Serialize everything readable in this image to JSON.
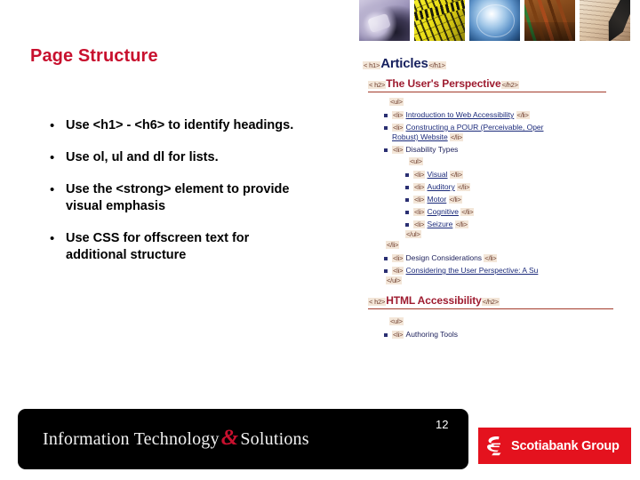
{
  "slide": {
    "title": "Page Structure",
    "page_number": "12"
  },
  "bullets": [
    {
      "marker": "•",
      "text": "Use <h1> - <h6> to identify headings."
    },
    {
      "marker": "•",
      "text": "Use ol, ul and dl for lists."
    },
    {
      "marker": "•",
      "text": "Use the <strong> element to provide visual emphasis"
    },
    {
      "marker": "•",
      "text": "Use CSS for offscreen text for additional structure"
    }
  ],
  "code_screenshot": {
    "h1": {
      "open_tag": "< h1>",
      "title": "Articles",
      "close_tag": "</h1>"
    },
    "h2_user_perspective": {
      "open_tag": "< h2>",
      "title": "The User's Perspective",
      "close_tag": "</h2>"
    },
    "ul_open": "<ul>",
    "ul_open_nested": "<ul>",
    "ul_close_nested": "</ul>",
    "li_close_outer": "</li>",
    "ul_close": "</ul>",
    "li_open": "<li>",
    "li_close": "</li>",
    "items": [
      {
        "label": "Introduction to Web Accessibility",
        "link": true
      },
      {
        "label": "Constructing a POUR (Perceivable, Oper",
        "label2": "Robust) Website",
        "link": true
      },
      {
        "label": "Disability Types",
        "link": false
      }
    ],
    "disability_types": [
      "Visual",
      "Auditory",
      "Motor",
      "Cognitive",
      "Seizure"
    ],
    "items_after": [
      {
        "label": "Design Considerations",
        "link": false
      },
      {
        "label": "Considering the User Perspective: A Su",
        "link": true
      }
    ],
    "h2_html_accessibility": {
      "open_tag": "< h2>",
      "title": "HTML Accessibility",
      "close_tag": "</h2>"
    },
    "ul_open_2": "<ul>",
    "items_html": [
      {
        "label": "Authoring Tools",
        "link": false
      }
    ]
  },
  "footer": {
    "org_part1": "Information Technology",
    "org_amp": "&",
    "org_part2": "Solutions",
    "brand": "Scotiabank Group"
  },
  "thumbnails": [
    {
      "name": "computer-mouse-photo"
    },
    {
      "name": "circuit-board-photo"
    },
    {
      "name": "blue-sphere-photo"
    },
    {
      "name": "network-cables-photo"
    },
    {
      "name": "pen-writing-photo"
    }
  ],
  "colors": {
    "title_red": "#C8102E",
    "brand_red": "#E4121E",
    "code_navy": "#16205e",
    "code_maroon": "#9e1b2f",
    "link_blue": "#1b2a7a",
    "tag_bg": "#f3e6d8",
    "footer_black": "#000000"
  }
}
